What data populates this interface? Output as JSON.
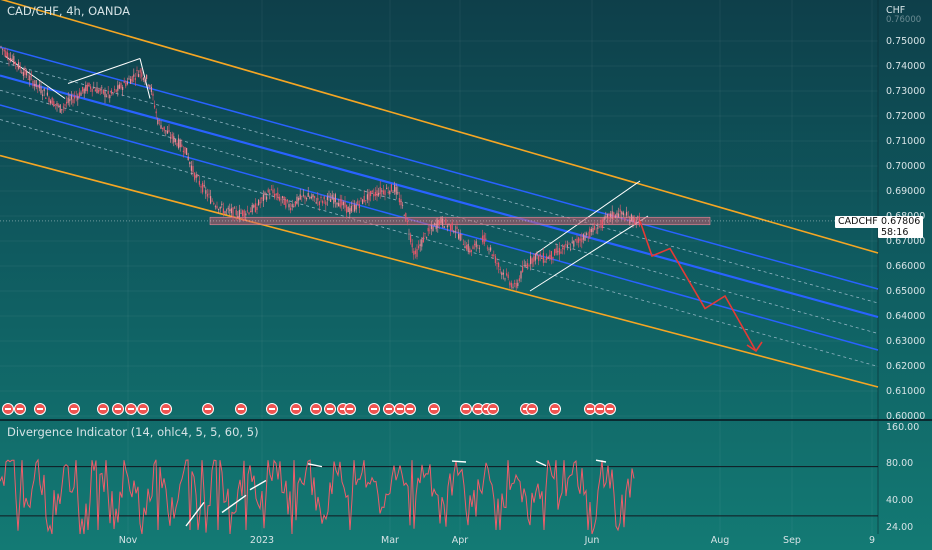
{
  "header": {
    "symbol": "CAD/CHF, 4h, OANDA",
    "currency": "CHF"
  },
  "price_axis": {
    "ticks": [
      "0.75000",
      "0.74000",
      "0.73000",
      "0.72000",
      "0.71000",
      "0.70000",
      "0.69000",
      "0.68000",
      "0.67000",
      "0.66000",
      "0.65000",
      "0.64000",
      "0.63000",
      "0.62000",
      "0.61000",
      "0.60000"
    ],
    "top_partial": "0.76000"
  },
  "last_price": {
    "ticker": "CADCHF",
    "value": "0.67806",
    "countdown": "58:16"
  },
  "indicator": {
    "title": "Divergence Indicator (14, ohlc4, 5, 5, 60, 5)",
    "ticks": [
      "160.00",
      "80.00",
      "40.00",
      "24.00"
    ]
  },
  "time_axis": [
    "Nov",
    "2023",
    "Mar",
    "Apr",
    "Jun",
    "Aug",
    "Sep",
    "9"
  ],
  "colors": {
    "background_top": "#0e3f4a",
    "background_bottom": "#137a74",
    "channel": "#f5a623",
    "regression": "#2962ff",
    "candle": "#e8576a",
    "projection": "#e53935",
    "zone": "#c25b6e",
    "bubble": "#ef5350"
  },
  "chart_data": {
    "type": "line",
    "title": "CAD/CHF, 4h, OANDA",
    "ylabel": "CHF",
    "ylim": [
      0.6,
      0.76
    ],
    "x_ticks": [
      "Nov",
      "2023",
      "Mar",
      "Apr",
      "Jun",
      "Aug",
      "Sep",
      "9"
    ],
    "series": [
      {
        "x": [
          0,
          30,
          60,
          90,
          110,
          140,
          150,
          158,
          170,
          185,
          195,
          210,
          225,
          240,
          255,
          270,
          290,
          305,
          320,
          335,
          350,
          365,
          380,
          395,
          405,
          415,
          425,
          440,
          455,
          470,
          485,
          500,
          515,
          525,
          535,
          545,
          560,
          570,
          585,
          600,
          610,
          620,
          630,
          640
        ],
        "values": [
          0.748,
          0.735,
          0.723,
          0.732,
          0.728,
          0.738,
          0.733,
          0.718,
          0.712,
          0.707,
          0.696,
          0.687,
          0.682,
          0.681,
          0.683,
          0.69,
          0.684,
          0.688,
          0.686,
          0.687,
          0.682,
          0.687,
          0.69,
          0.691,
          0.681,
          0.664,
          0.672,
          0.678,
          0.675,
          0.666,
          0.671,
          0.659,
          0.651,
          0.66,
          0.664,
          0.663,
          0.666,
          0.668,
          0.672,
          0.676,
          0.68,
          0.681,
          0.679,
          0.678
        ]
      },
      {
        "x": [
          640,
          652,
          670,
          705,
          725,
          756
        ],
        "values": [
          0.678,
          0.664,
          0.667,
          0.643,
          0.648,
          0.626
        ]
      }
    ],
    "zone": {
      "from": 0.6795,
      "to": 0.6765
    },
    "channel": {
      "upper": {
        "x": [
          0,
          878
        ],
        "values": [
          0.7668,
          0.6652
        ]
      },
      "lower": {
        "x": [
          0,
          878
        ],
        "values": [
          0.7042,
          0.6116
        ]
      }
    },
    "regression_lines": [
      {
        "x": [
          0,
          878
        ],
        "values": [
          0.7476,
          0.6508
        ]
      },
      {
        "x": [
          0,
          878
        ],
        "values": [
          0.7362,
          0.6396
        ]
      },
      {
        "x": [
          0,
          878
        ],
        "values": [
          0.7244,
          0.6264
        ]
      }
    ],
    "indicator": {
      "type": "line",
      "ylim": [
        20,
        160
      ],
      "ticks": [
        "160.00",
        "80.00",
        "40.00",
        "24.00"
      ],
      "levels": [
        75,
        30
      ]
    }
  }
}
